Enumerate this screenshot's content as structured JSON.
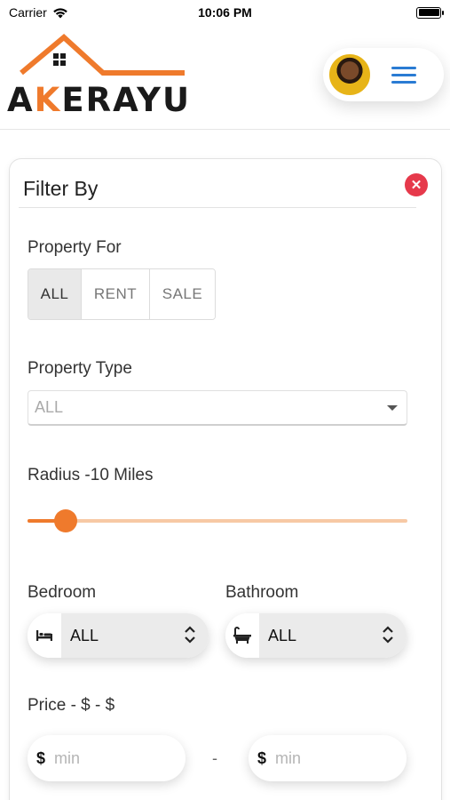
{
  "status_bar": {
    "carrier": "Carrier",
    "time": "10:06 PM",
    "battery_level": 1.0
  },
  "header": {
    "logo_text_a": "A",
    "logo_text_k": "K",
    "logo_text_rest": "ERAYU",
    "brand_color": "#ef7a2c",
    "menu_color": "#2a7bd3"
  },
  "filter": {
    "title": "Filter By",
    "property_for": {
      "label": "Property For",
      "options": [
        "ALL",
        "RENT",
        "SALE"
      ],
      "selected": "ALL"
    },
    "property_type": {
      "label": "Property Type",
      "value": "ALL"
    },
    "radius": {
      "label": "Radius -10 Miles",
      "value_fraction": 0.1
    },
    "bedroom": {
      "label": "Bedroom",
      "value": "ALL"
    },
    "bathroom": {
      "label": "Bathroom",
      "value": "ALL"
    },
    "price": {
      "label": "Price - $ - $",
      "currency": "$",
      "min_placeholder": "min",
      "max_placeholder": "min",
      "separator": "-"
    },
    "accent_color": "#ef7a2c",
    "close_color": "#e6394b"
  }
}
